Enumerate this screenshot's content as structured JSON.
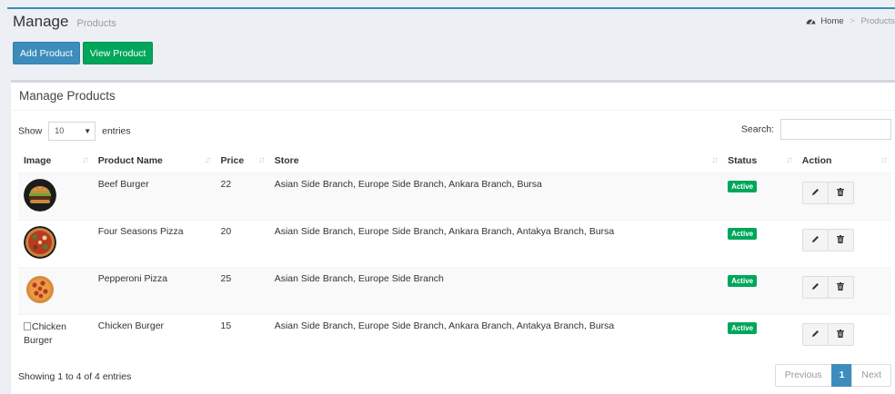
{
  "header": {
    "title": "Manage",
    "subtitle": "Products"
  },
  "breadcrumb": {
    "home_label": "Home",
    "separator": ">",
    "current": "Products"
  },
  "buttons": {
    "add_product": "Add Product",
    "view_product": "View Product"
  },
  "box": {
    "title": "Manage Products"
  },
  "datatable": {
    "length_prefix": "Show",
    "length_value": "10",
    "length_suffix": "entries",
    "search_label": "Search:",
    "search_value": "",
    "info": "Showing 1 to 4 of 4 entries",
    "pagination": {
      "previous": "Previous",
      "current_page": "1",
      "next": "Next"
    }
  },
  "table": {
    "columns": [
      "Image",
      "Product Name",
      "Price",
      "Store",
      "Status",
      "Action"
    ],
    "rows": [
      {
        "image_icon": "beef-burger-thumbnail",
        "name": "Beef Burger",
        "price": "22",
        "store": "Asian Side Branch, Europe Side Branch, Ankara Branch, Bursa",
        "status": "Active"
      },
      {
        "image_icon": "four-seasons-pizza-thumbnail",
        "name": "Four Seasons Pizza",
        "price": "20",
        "store": "Asian Side Branch, Europe Side Branch, Ankara Branch, Antakya Branch, Bursa",
        "status": "Active"
      },
      {
        "image_icon": "pepperoni-pizza-thumbnail",
        "name": "Pepperoni Pizza",
        "price": "25",
        "store": "Asian Side Branch, Europe Side Branch",
        "status": "Active"
      },
      {
        "image_alt": "Chicken Burger",
        "image_alt_line1": "Chicken",
        "image_alt_line2": "Burger",
        "name": "Chicken Burger",
        "price": "15",
        "store": "Asian Side Branch, Europe Side Branch, Ankara Branch, Antakya Branch, Bursa",
        "status": "Active"
      }
    ]
  },
  "colors": {
    "primary": "#3c8dbc",
    "success": "#00a65a",
    "background": "#ecf0f5"
  },
  "icons": {
    "breadcrumb_home": "dashboard-icon",
    "edit": "pencil-icon",
    "delete": "trash-icon",
    "sort": "sort-arrows-icon"
  }
}
